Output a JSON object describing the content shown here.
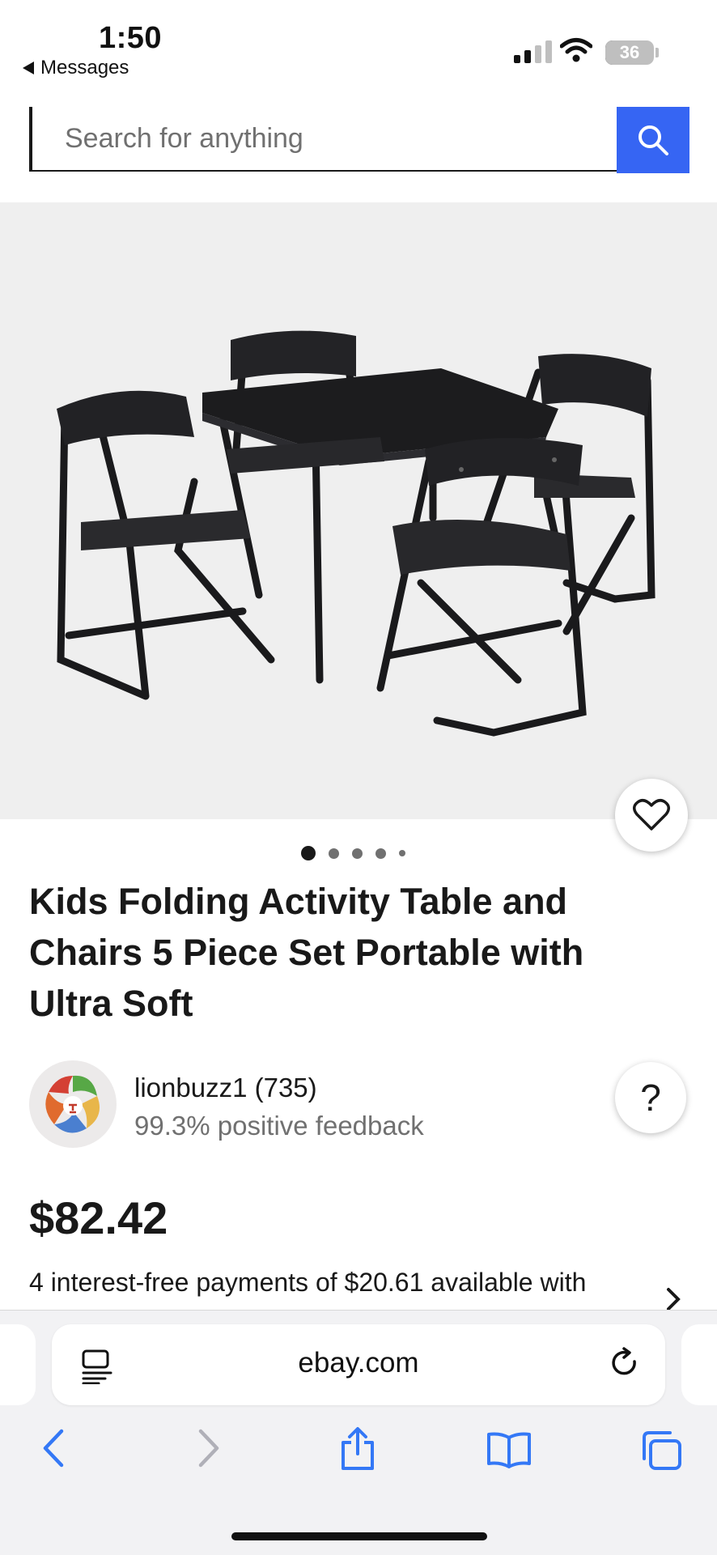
{
  "status_bar": {
    "time": "1:50",
    "back_label": "Messages",
    "battery": "36"
  },
  "search": {
    "placeholder": "Search for anything"
  },
  "product": {
    "title": "Kids Folding Activity Table and Chairs 5 Piece Set Portable with Ultra Soft",
    "image_count": 5,
    "active_image": 1
  },
  "seller": {
    "name": "lionbuzz1 (735)",
    "feedback": "99.3% positive feedback"
  },
  "help": {
    "label": "?"
  },
  "pricing": {
    "price": "$82.42",
    "payments": "4 interest-free payments of $20.61 available with"
  },
  "browser": {
    "url": "ebay.com"
  },
  "colors": {
    "accent": "#3665f3",
    "safari_blue": "#3478f6"
  }
}
